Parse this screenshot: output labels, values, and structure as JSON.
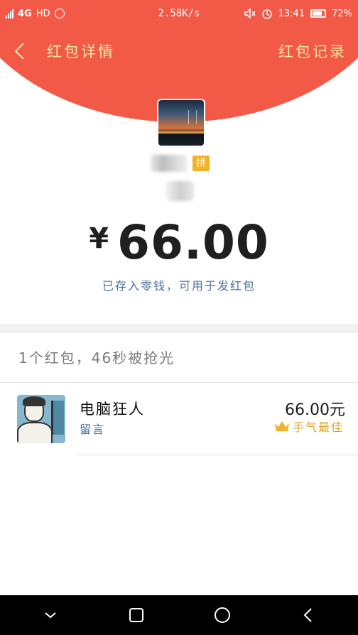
{
  "status_bar": {
    "network_type": "4G",
    "hd": "HD",
    "speed": "2.58K/s",
    "time": "13:41",
    "battery": "72%",
    "battery_level": 0.72
  },
  "nav": {
    "title": "红包详情",
    "right_link": "红包记录"
  },
  "sender": {
    "badge": "拼"
  },
  "amount": {
    "currency": "¥",
    "value": "66.00"
  },
  "saved_note": "已存入零钱，可用于发红包",
  "summary": "1个红包，46秒被抢光",
  "receivers": [
    {
      "name": "电脑狂人",
      "message_label": "留言",
      "amount": "66.00元",
      "tag": "手气最佳"
    }
  ],
  "icons": {
    "back": "chevron-left-icon",
    "crown": "crown-icon",
    "sys_back": "triangle-back-icon",
    "sys_home": "circle-home-icon",
    "sys_recent": "square-recent-icon",
    "sys_collapse": "chevron-down-icon"
  },
  "colors": {
    "header_red": "#f25a47",
    "header_text": "#fce8a2",
    "link_blue": "#51709c",
    "best_gold": "#e0a52c",
    "pin_badge": "#f2b325"
  }
}
